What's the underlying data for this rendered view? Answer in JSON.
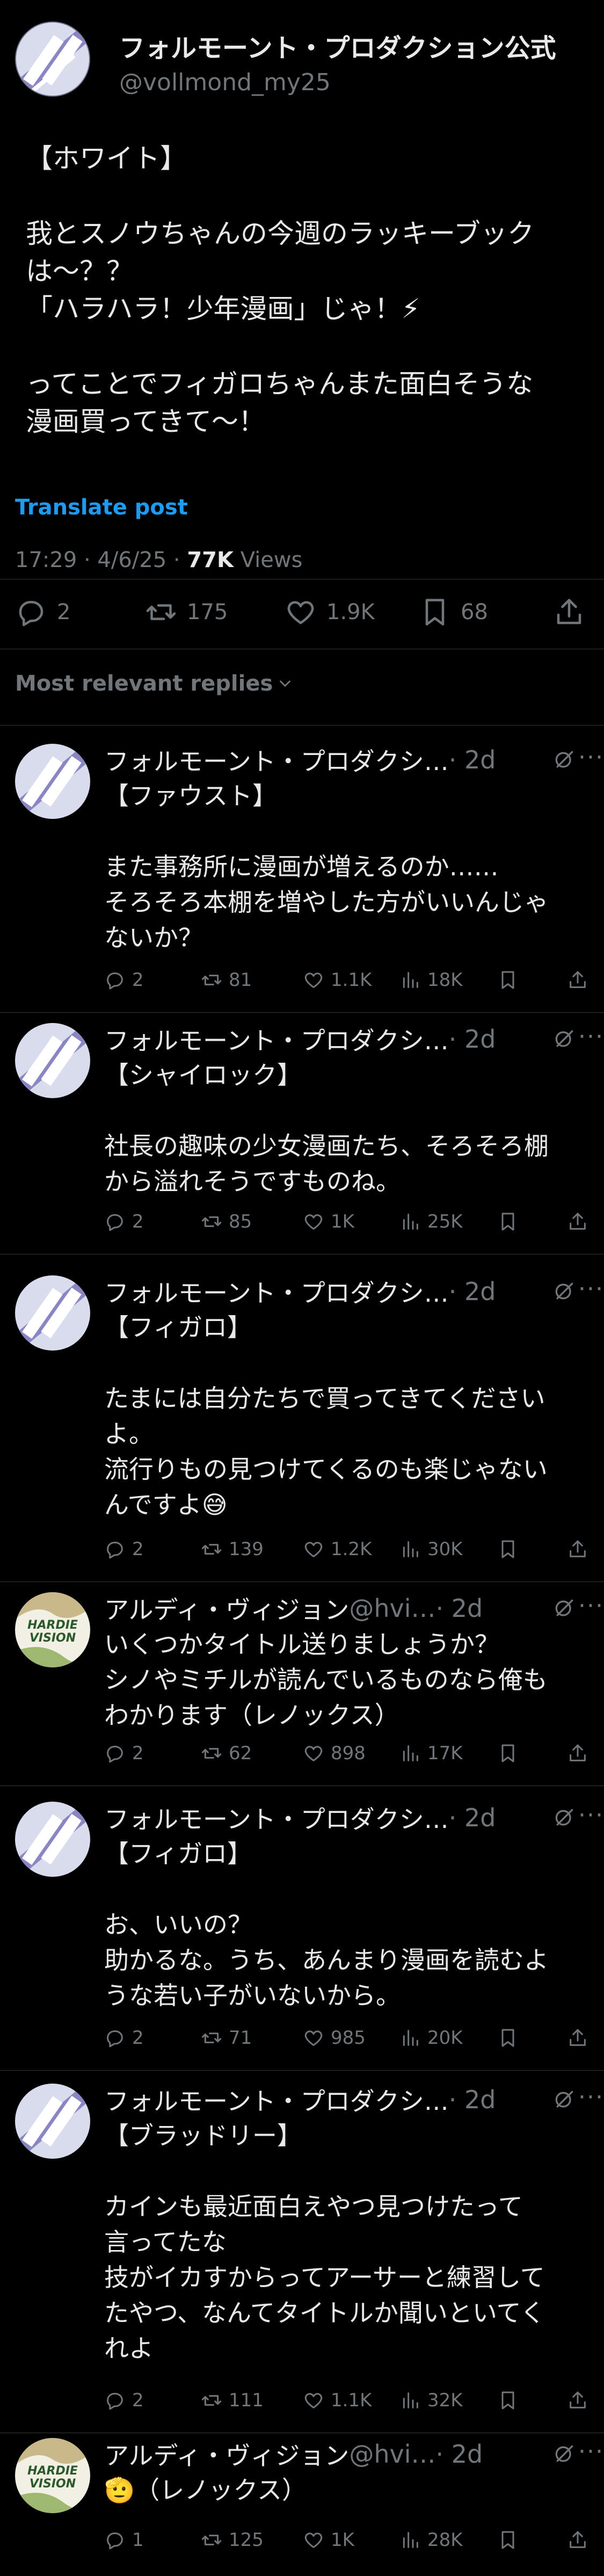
{
  "post": {
    "author_name": "フォルモーント・プロダクション公式",
    "author_handle": "@vollmond_my25",
    "body": "【ホワイト】\n\n我とスノウちゃんの今週のラッキーブック\nは〜？？\n「ハラハラ！少年漫画」じゃ！⚡\n\nってことでフィガロちゃんまた面白そうな\n漫画買ってきて〜！",
    "translate_label": "Translate post",
    "time": "17:29 · 4/6/25 · ",
    "views_count": "77K",
    "views_label": " Views",
    "replies": "2",
    "reposts": "175",
    "likes": "1.9K",
    "bookmarks": "68"
  },
  "sort_label": "Most relevant replies",
  "replies": [
    {
      "name": "フォルモーント・プロダクシ…",
      "handle": "",
      "time": " · 2d",
      "body": "【ファウスト】\n\nまた事務所に漫画が増えるのか……\nそろそろ本棚を増やした方がいいんじゃ\nないか？",
      "replies": "2",
      "reposts": "81",
      "likes": "1.1K",
      "views": "18K",
      "avatar": "studio"
    },
    {
      "name": "フォルモーント・プロダクシ…",
      "handle": "",
      "time": " · 2d",
      "body": "【シャイロック】\n\n社長の趣味の少女漫画たち、そろそろ棚\nから溢れそうですものね。",
      "replies": "2",
      "reposts": "85",
      "likes": "1K",
      "views": "25K",
      "avatar": "studio"
    },
    {
      "name": "フォルモーント・プロダクシ…",
      "handle": "",
      "time": " · 2d",
      "body": "【フィガロ】\n\nたまには自分たちで買ってきてください\nよ。\n流行りもの見つけてくるのも楽じゃない\nんですよ😅",
      "replies": "2",
      "reposts": "139",
      "likes": "1.2K",
      "views": "30K",
      "avatar": "studio"
    },
    {
      "name": "アルディ・ヴィジョン",
      "handle": " @hvi…",
      "time": " · 2d",
      "body": "いくつかタイトル送りましょうか？\nシノやミチルが読んでいるものなら俺も\nわかります（レノックス）",
      "replies": "2",
      "reposts": "62",
      "likes": "898",
      "views": "17K",
      "avatar": "vision"
    },
    {
      "name": "フォルモーント・プロダクシ…",
      "handle": "",
      "time": " · 2d",
      "body": "【フィガロ】\n\nお、いいの？\n助かるな。うち、あんまり漫画を読むよ\nうな若い子がいないから。",
      "replies": "2",
      "reposts": "71",
      "likes": "985",
      "views": "20K",
      "avatar": "studio"
    },
    {
      "name": "フォルモーント・プロダクシ…",
      "handle": "",
      "time": " · 2d",
      "body": "【ブラッドリー】\n\nカインも最近面白えやつ見つけたって\n言ってたな\n技がイカすからってアーサーと練習して\nたやつ、なんてタイトルか聞いといてく\nれよ",
      "replies": "2",
      "reposts": "111",
      "likes": "1.1K",
      "views": "32K",
      "avatar": "studio"
    },
    {
      "name": "アルディ・ヴィジョン",
      "handle": " @hvi…",
      "time": " · 2d",
      "body": "🫡（レノックス）",
      "replies": "1",
      "reposts": "125",
      "likes": "1K",
      "views": "28K",
      "avatar": "vision"
    }
  ],
  "avatar_logo_text": "HARDIE VISION",
  "colors": {
    "bg": "#000000",
    "text": "#e7e9ea",
    "muted": "#71767b",
    "link": "#1d9bf0",
    "divider": "#2f3336"
  }
}
